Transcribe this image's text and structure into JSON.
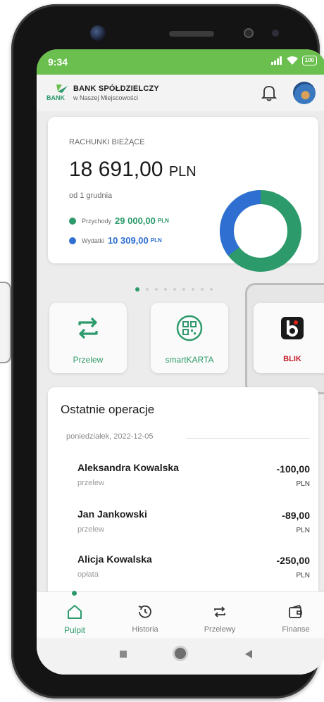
{
  "status": {
    "time": "9:34",
    "battery": "100"
  },
  "header": {
    "bank_name": "BANK SPÓŁDZIELCZY",
    "bank_subtitle": "w Naszej Miejscowości",
    "logo_text": "BANK"
  },
  "account": {
    "title": "RACHUNKI BIEŻĄCE",
    "amount": "18 691,00",
    "currency": "PLN",
    "since": "od 1 grudnia",
    "income_label": "Przychody",
    "income_value": "29 000,00",
    "expense_label": "Wydatki",
    "expense_value": "10 309,00",
    "unit": "PLN",
    "income_color": "#2c9a6b",
    "expense_color": "#2f6fd1",
    "expense_share": 0.355
  },
  "carousel": {
    "pages": 9,
    "active": 0
  },
  "quick_actions": [
    {
      "label": "Przelew",
      "icon": "transfer-icon"
    },
    {
      "label": "smartKARTA",
      "icon": "qr-code-icon"
    },
    {
      "label": "BLIK",
      "icon": "blik-logo-icon"
    }
  ],
  "recent": {
    "title": "Ostatnie operacje",
    "date": "poniedziałek, 2022-12-05",
    "items": [
      {
        "name": "Aleksandra Kowalska",
        "type": "przelew",
        "amount": "-100,00",
        "currency": "PLN"
      },
      {
        "name": "Jan Jankowski",
        "type": "przelew",
        "amount": "-89,00",
        "currency": "PLN"
      },
      {
        "name": "Alicja Kowalska",
        "type": "opłata",
        "amount": "-250,00",
        "currency": "PLN"
      }
    ]
  },
  "nav": {
    "items": [
      {
        "label": "Pulpit",
        "icon": "home-icon",
        "active": true
      },
      {
        "label": "Historia",
        "icon": "history-icon"
      },
      {
        "label": "Przelewy",
        "icon": "transfers-icon"
      },
      {
        "label": "Finanse",
        "icon": "wallet-icon"
      }
    ]
  },
  "colors": {
    "brand_green": "#6bbf4e",
    "accent": "#2c9a6b",
    "blik_red": "#c51b2a"
  }
}
